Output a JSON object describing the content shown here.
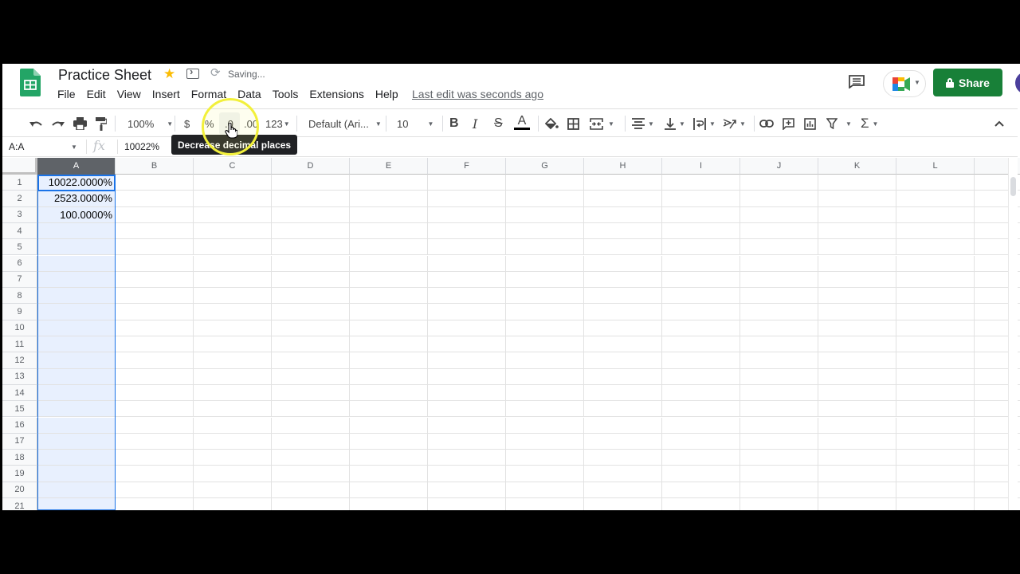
{
  "document": {
    "title": "Practice Sheet",
    "save_status": "Saving...",
    "last_edit": "Last edit was seconds ago"
  },
  "menu": [
    "File",
    "Edit",
    "View",
    "Insert",
    "Format",
    "Data",
    "Tools",
    "Extensions",
    "Help"
  ],
  "header_actions": {
    "share_label": "Share"
  },
  "toolbar": {
    "zoom": "100%",
    "currency": "$",
    "percent": "%",
    "decrease_decimal": ".0",
    "increase_decimal": ".00",
    "more_formats": "123",
    "font": "Default (Ari...",
    "font_size": "10",
    "bold": "B",
    "italic": "I",
    "strikethrough": "S",
    "text_color_letter": "A",
    "text_color": "#000000",
    "functions": "Σ"
  },
  "tooltip": "Decrease decimal places",
  "formula_bar": {
    "name_box": "A:A",
    "fx": "fx",
    "value": "10022%"
  },
  "grid": {
    "columns": [
      "A",
      "B",
      "C",
      "D",
      "E",
      "F",
      "G",
      "H",
      "I",
      "J",
      "K",
      "L"
    ],
    "selected_column": "A",
    "rows": [
      "1",
      "2",
      "3",
      "4",
      "5",
      "6",
      "7",
      "8",
      "9",
      "10",
      "11",
      "12",
      "13",
      "14",
      "15",
      "16",
      "17",
      "18",
      "19",
      "20",
      "21"
    ],
    "cells": {
      "A1": "10022.0000%",
      "A2": "2523.0000%",
      "A3": "100.0000%"
    }
  },
  "colors": {
    "brand_green": "#188038",
    "selection_blue": "#1a73e8",
    "selection_fill": "#e8f0fe",
    "star": "#fbbc04"
  }
}
